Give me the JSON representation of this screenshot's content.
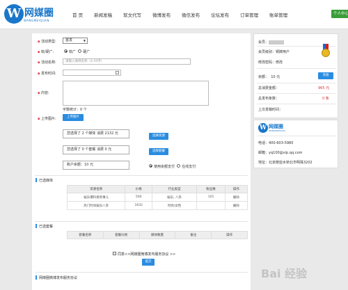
{
  "header": {
    "logo_name": "网媒圈",
    "logo_sub": "WANGMEIQUAN",
    "nav": [
      "首 页",
      "新闻发稿",
      "软文代写",
      "微博发布",
      "微信发布",
      "论坛发布",
      "订单管理",
      "账单管理"
    ],
    "personal_center": "个人中心"
  },
  "form": {
    "activity_type_label": "活动类型:",
    "activity_type_value": "首发",
    "ad_type_label": "软/硬广:",
    "ad_soft": "软广",
    "ad_hard": "硬广",
    "activity_name_label": "活动名称:",
    "activity_name_placeholder": "请输入微博名称（4-20字）",
    "publish_time_label": "发布时间:",
    "content_label": "内容:",
    "word_count": "字数统计：0 个",
    "upload_label": "上传图片:",
    "upload_button": "上传图片",
    "selected_media_text": "您选择了 2 个媒体 消费 2132 元",
    "select_resources_button": "选择资源",
    "selected_packages_text": "您选择了 0 个套餐 消费 0 元",
    "select_package_button": "选择套餐",
    "balance_text": "账户余额：10 元",
    "pay_balance": "使用余额支付",
    "pay_online": "在线支付"
  },
  "selected_media": {
    "title": "已选媒体",
    "columns": [
      "资源名称",
      "价格",
      "行业类型",
      "粉丝数",
      "操作"
    ],
    "rows": [
      [
        "娱乐爆料者新事儿",
        "500",
        "娱乐, 八卦",
        "101",
        "删除"
      ],
      [
        "热门时尚娱乐八卦",
        "1632",
        "时尚/女性",
        "",
        "删除"
      ]
    ]
  },
  "selected_packages": {
    "title": "已选套餐",
    "columns": [
      "套餐名称",
      "套餐价格",
      "媒体数量",
      "备注",
      "操作"
    ]
  },
  "agreement": {
    "text": "同意<<网媒圈微博发布服务协议 >>",
    "submit": "提交",
    "bottom_title": "网媒圈微博发布服务协议"
  },
  "account": {
    "member_label": "会员：",
    "level_label": "会员级别：",
    "level_value": "铜牌用户",
    "pwd_label": "修改密码：",
    "pwd_value": "修改",
    "balance_label": "余额：",
    "balance_value": "10 元",
    "recharge": "充值",
    "total_spent_label": "总消费金额：",
    "total_spent_value": "965 元",
    "total_posts_label": "总发布条数：",
    "total_posts_value": "0 条",
    "last_time_label": "上次发稿时间："
  },
  "contact": {
    "logo_name": "网媒圈",
    "logo_sub": "WANGMEIQUAN",
    "phone": "电话：400-603-5980",
    "email": "邮箱：yq100@vip.qq.com",
    "address": "地址：北京丽亚水桥北市明珠3202"
  },
  "watermark": "Bai 经验",
  "colors": {
    "accent": "#2a8ce0",
    "brand": "#1a77c9",
    "danger": "#d33333",
    "green": "#3a9d3a"
  }
}
